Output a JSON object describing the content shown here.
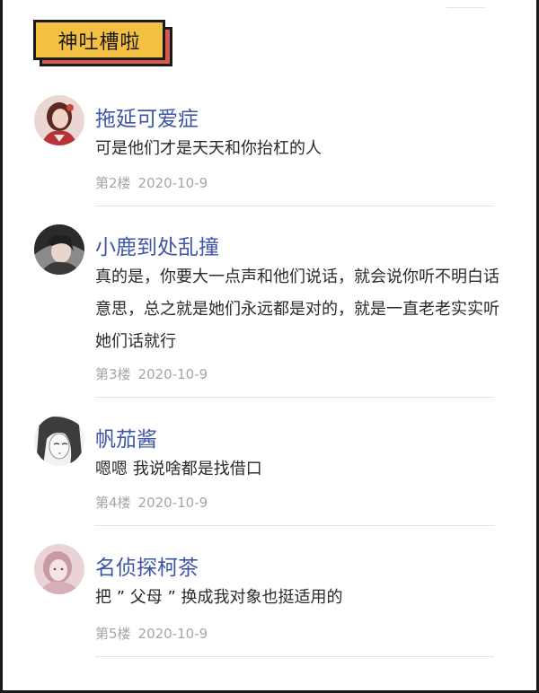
{
  "section": {
    "tag": "神吐槽啦"
  },
  "comments": [
    {
      "user": "拖延可爱症",
      "text": "可是他们才是天天和你抬杠的人",
      "floor": "第2楼",
      "date": "2020-10-9",
      "avatar": "avatar-girl-red-hanfu"
    },
    {
      "user": "小鹿到处乱撞",
      "text": "真的是，你要大一点声和他们说话，就会说你听不明白话意思，总之就是她们永远都是对的，就是一直老老实实听她们话就行",
      "floor": "第3楼",
      "date": "2020-10-9",
      "avatar": "avatar-girl-dark-hair"
    },
    {
      "user": "帆茄酱",
      "text": "嗯嗯 我说啥都是找借口",
      "floor": "第4楼",
      "date": "2020-10-9",
      "avatar": "avatar-sketch-face"
    },
    {
      "user": "名侦探柯茶",
      "text": "把 ” 父母 ” 换成我对象也挺适用的",
      "floor": "第5楼",
      "date": "2020-10-9",
      "avatar": "avatar-girl-pink"
    }
  ],
  "colors": {
    "accent_yellow": "#f4c043",
    "accent_red": "#d8594d",
    "name_blue": "#3f55a6"
  }
}
